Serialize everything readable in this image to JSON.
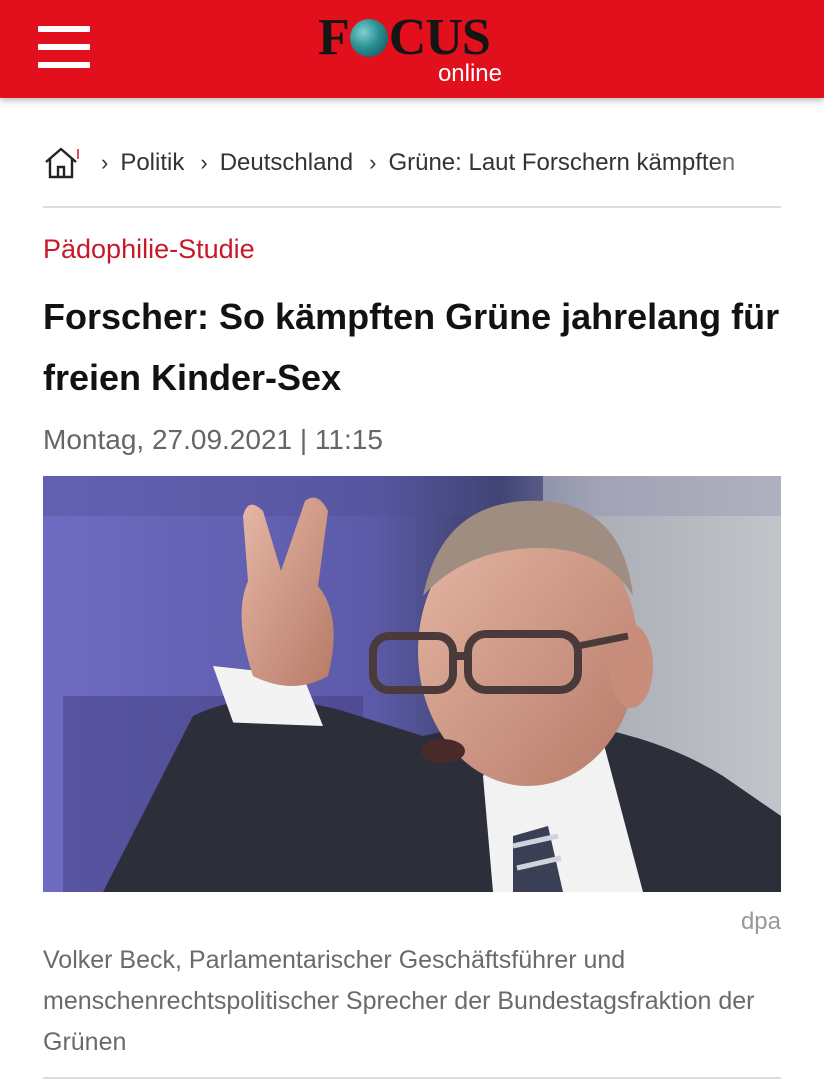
{
  "header": {
    "menu_icon": "hamburger-menu-icon",
    "logo": {
      "brand_f": "F",
      "brand_rest": "CUS",
      "sub": "online"
    },
    "colors": {
      "bar": "#e2101c",
      "logo_text": "#151515"
    }
  },
  "breadcrumb": {
    "home_icon": "home-icon",
    "separator": "›",
    "items": [
      "Politik",
      "Deutschland",
      "Grüne: Laut Forschern kämpften"
    ]
  },
  "article": {
    "kicker": "Pädophilie-Studie",
    "headline": "Forscher: So kämpften Grüne jahrelang für freien Kinder-Sex",
    "date": "Montag, 27.09.2021 | 11:15",
    "image": {
      "credit": "dpa",
      "caption": "Volker Beck, Parlamentarischer Geschäftsführer und menschenrechtspolitischer Sprecher der Bundestagsfraktion der Grünen"
    },
    "colors": {
      "kicker": "#c8182a"
    }
  }
}
